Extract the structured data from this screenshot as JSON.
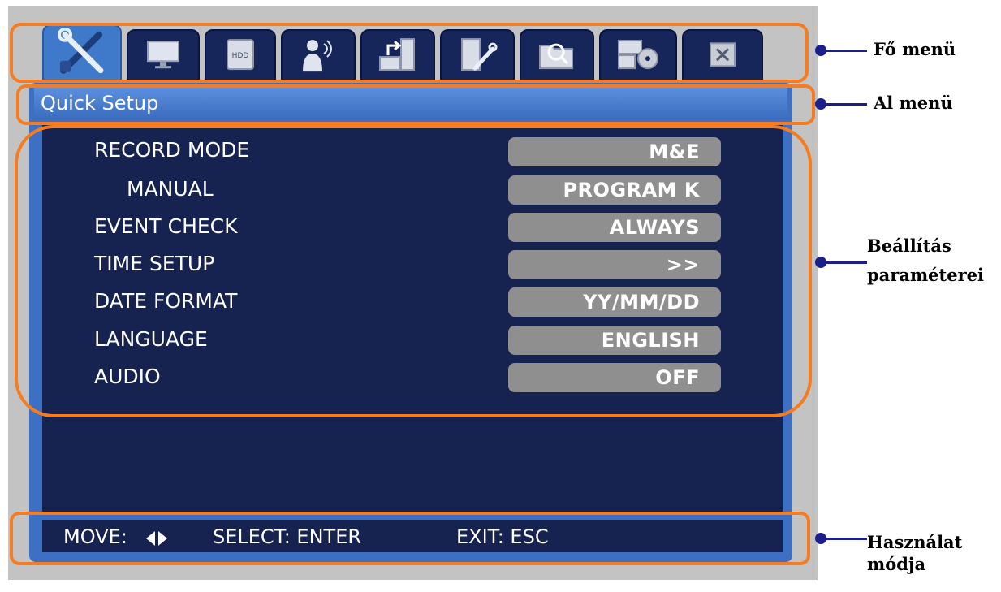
{
  "tabs": [
    {
      "icon": "tools-icon",
      "active": true
    },
    {
      "icon": "monitor-icon"
    },
    {
      "icon": "hdd-icon",
      "text": "HDD"
    },
    {
      "icon": "person-signal-icon"
    },
    {
      "icon": "network-icon"
    },
    {
      "icon": "system-tools-icon"
    },
    {
      "icon": "folder-search-icon"
    },
    {
      "icon": "backup-disc-icon"
    },
    {
      "icon": "close-icon"
    }
  ],
  "submenu": {
    "title": "Quick Setup"
  },
  "settings": [
    {
      "label": "RECORD MODE",
      "value": "M&E"
    },
    {
      "label": "MANUAL",
      "value": "PROGRAM K"
    },
    {
      "label": "EVENT CHECK",
      "value": "ALWAYS"
    },
    {
      "label": "TIME SETUP",
      "value": ">>"
    },
    {
      "label": "DATE FORMAT",
      "value": "YY/MM/DD"
    },
    {
      "label": "LANGUAGE",
      "value": "ENGLISH"
    },
    {
      "label": "AUDIO",
      "value": "OFF"
    }
  ],
  "footer": {
    "move": "MOVE:",
    "move_icon": "left-right-arrows-icon",
    "select": "SELECT: ENTER",
    "exit": "EXIT: ESC"
  },
  "annotations": {
    "main_menu": "Fő menü",
    "sub_menu": "Al menü",
    "params_line1": "Beállítás",
    "params_line2": "paraméterei",
    "usage_line1": "Használat",
    "usage_line2": "módja"
  },
  "colors": {
    "highlight": "#f57c20",
    "panel": "#16224f",
    "frame": "#3d6fc2",
    "value_box": "#8f8f8f",
    "leader": "#1b1f8a"
  }
}
